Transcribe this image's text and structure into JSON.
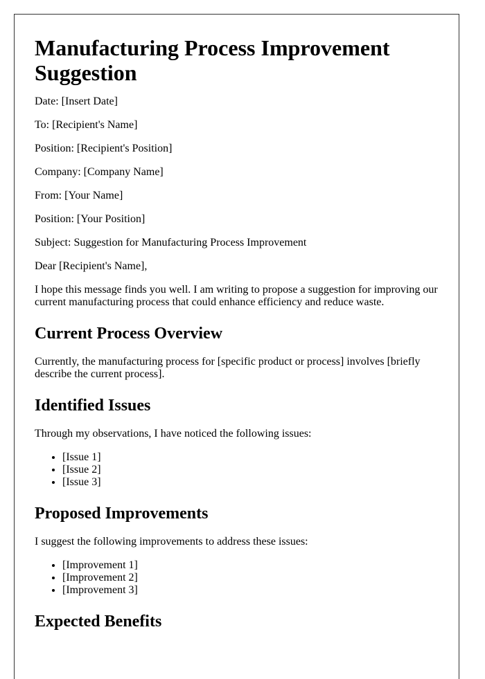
{
  "title": "Manufacturing Process Improvement Suggestion",
  "header_fields": [
    {
      "label": "Date:",
      "value": "[Insert Date]"
    },
    {
      "label": "To:",
      "value": "[Recipient's Name]"
    },
    {
      "label": "Position:",
      "value": "[Recipient's Position]"
    },
    {
      "label": "Company:",
      "value": "[Company Name]"
    },
    {
      "label": "From:",
      "value": "[Your Name]"
    },
    {
      "label": "Position:",
      "value": "[Your Position]"
    },
    {
      "label": "Subject:",
      "value": "Suggestion for Manufacturing Process Improvement"
    }
  ],
  "salutation": "Dear [Recipient's Name],",
  "intro": "I hope this message finds you well. I am writing to propose a suggestion for improving our current manufacturing process that could enhance efficiency and reduce waste.",
  "sections": {
    "current": {
      "heading": "Current Process Overview",
      "text": "Currently, the manufacturing process for [specific product or process] involves [briefly describe the current process]."
    },
    "issues": {
      "heading": "Identified Issues",
      "text": "Through my observations, I have noticed the following issues:",
      "items": [
        "[Issue 1]",
        "[Issue 2]",
        "[Issue 3]"
      ]
    },
    "improvements": {
      "heading": "Proposed Improvements",
      "text": "I suggest the following improvements to address these issues:",
      "items": [
        "[Improvement 1]",
        "[Improvement 2]",
        "[Improvement 3]"
      ]
    },
    "benefits": {
      "heading": "Expected Benefits"
    }
  }
}
